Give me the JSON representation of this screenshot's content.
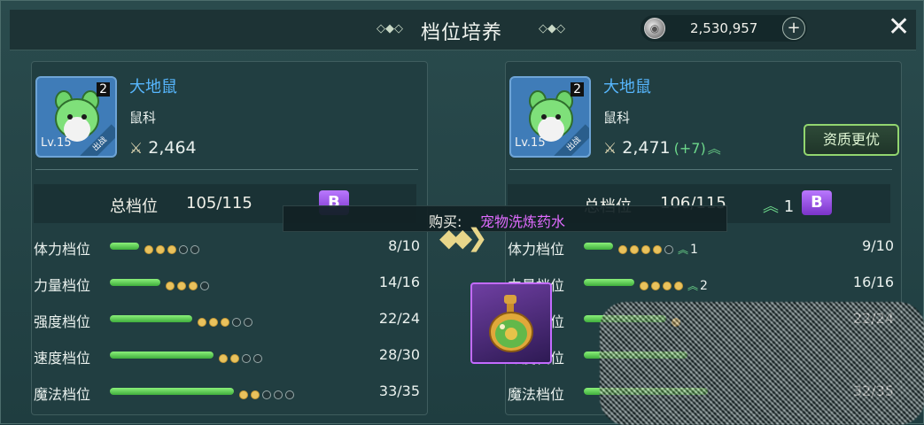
{
  "header": {
    "title": "档位培养",
    "currency_value": "2,530,957",
    "plus_label": "+",
    "close_label": "✕",
    "deco_left": "◇◆◇",
    "deco_right": "◇◆◇"
  },
  "left": {
    "name": "大地鼠",
    "family": "鼠科",
    "level": "Lv.15",
    "badge": "出战",
    "star": "2",
    "power": "2,464",
    "tier_label": "总档位",
    "tier_value": "105/115",
    "grade": "B",
    "stats": [
      {
        "label": "体力档位",
        "value": "8/10",
        "fill": 0.22,
        "dots_on": 3,
        "dots_off": 2
      },
      {
        "label": "力量档位",
        "value": "14/16",
        "fill": 0.38,
        "dots_on": 3,
        "dots_off": 1
      },
      {
        "label": "强度档位",
        "value": "22/24",
        "fill": 0.62,
        "dots_on": 3,
        "dots_off": 2
      },
      {
        "label": "速度档位",
        "value": "28/30",
        "fill": 0.78,
        "dots_on": 2,
        "dots_off": 2
      },
      {
        "label": "魔法档位",
        "value": "33/35",
        "fill": 0.93,
        "dots_on": 2,
        "dots_off": 3
      }
    ]
  },
  "right": {
    "name": "大地鼠",
    "family": "鼠科",
    "level": "Lv.15",
    "badge": "出战",
    "star": "2",
    "power": "2,471",
    "power_delta": "(+7)",
    "upgrade_label": "资质更优",
    "tier_label": "总档位",
    "tier_value": "106/115",
    "tier_up": "1",
    "grade": "B",
    "stats": [
      {
        "label": "体力档位",
        "value": "9/10",
        "fill": 0.22,
        "dots_on": 4,
        "dots_off": 1,
        "up": "1"
      },
      {
        "label": "力量档位",
        "value": "16/16",
        "fill": 0.38,
        "dots_on": 4,
        "dots_off": 0,
        "up": "2"
      },
      {
        "label": "强度档位",
        "value": "22/24",
        "fill": 0.62,
        "dots_on": 1,
        "dots_off": 0,
        "up": ""
      },
      {
        "label": "速度档位",
        "value": "",
        "fill": 0.78,
        "dots_on": 0,
        "dots_off": 0,
        "up": ""
      },
      {
        "label": "魔法档位",
        "value": "32/35",
        "fill": 0.93,
        "dots_on": 0,
        "dots_off": 0,
        "up": ""
      }
    ]
  },
  "buy": {
    "label": "购买:",
    "item": "宠物洗炼药水"
  },
  "colors": {
    "name_blue": "#57b7ff",
    "green": "#6dd88b",
    "purple": "#e06bff"
  }
}
